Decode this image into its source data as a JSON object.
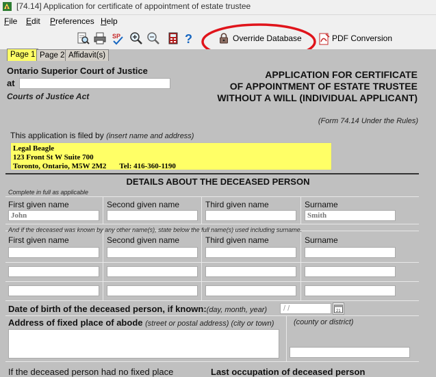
{
  "window": {
    "title": "[74.14] Application for certificate of appointment of estate trustee"
  },
  "menu": [
    "File",
    "Edit",
    "Preferences",
    "Help"
  ],
  "toolbar": {
    "icons": [
      "document-search-icon",
      "printer-icon",
      "spellcheck-icon",
      "zoom-in-icon",
      "zoom-out-icon",
      "calculator-icon",
      "help-icon"
    ],
    "override_label": "Override Database",
    "pdf_label": "PDF Conversion",
    "highlight_color": "#e0141b"
  },
  "tabs": [
    {
      "label": "Page 1",
      "active": true
    },
    {
      "label": "Page 2",
      "active": false
    },
    {
      "label": "Affidavit(s)",
      "active": false
    }
  ],
  "form": {
    "court": "Ontario Superior Court of Justice",
    "at_label": "at",
    "at_value": "",
    "act": "Courts of Justice Act",
    "title_lines": [
      "APPLICATION FOR CERTIFICATE",
      "OF APPOINTMENT OF ESTATE TRUSTEE",
      "WITHOUT A WILL (INDIVIDUAL APPLICANT)"
    ],
    "form_ref": "(Form 74.14 Under the Rules)",
    "filed_by_label": "This application is filed by",
    "filed_by_hint": "(insert name and address)",
    "filer_lines": [
      "Legal Beagle",
      "123 Front St W Suite 700",
      "Toronto, Ontario, M5W 2M2       Tel: 416-360-1190"
    ],
    "section_title": "DETAILS ABOUT THE DECEASED PERSON",
    "complete_note": "Complete in full as applicable",
    "name_columns": [
      "First given name",
      "Second given name",
      "Third given name",
      "Surname"
    ],
    "deceased_name": {
      "first": "John",
      "second": "",
      "third": "",
      "surname": "Smith"
    },
    "other_names_note": "And if the deceased was known by any other name(s), state below the full name(s) used including surname.",
    "other_name_columns": [
      "First given name",
      "Second given name",
      "Third given name",
      "Surname"
    ],
    "dob_label": "Date of birth of the deceased person, if known:",
    "dob_hint": "(day, month, year)",
    "dob_value": "/  /",
    "address_label": "Address of fixed place of abode",
    "address_hint": "(street or postal address)  (city or town)",
    "county_label": "(county or district)",
    "no_fixed_place": "If the deceased person had no fixed place",
    "last_occupation": "Last occupation of deceased person"
  }
}
